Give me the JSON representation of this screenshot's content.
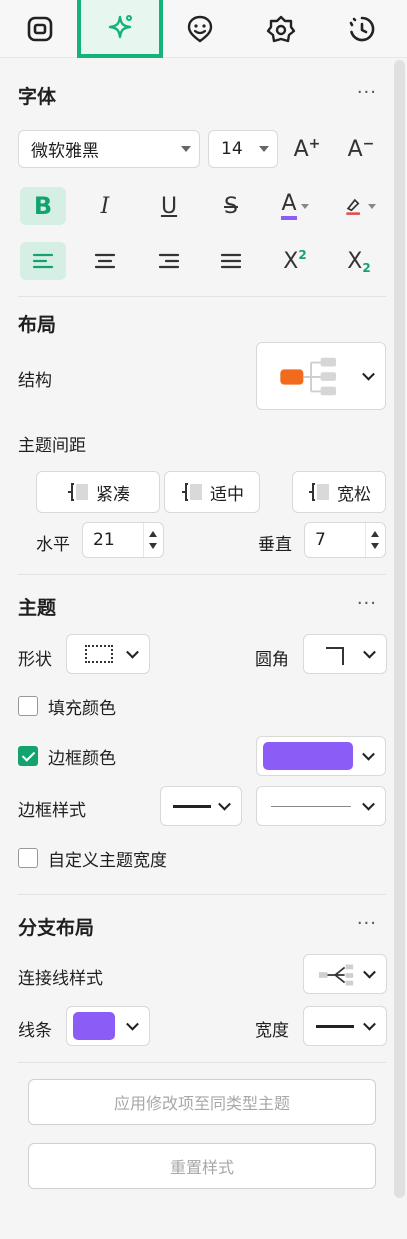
{
  "tabs": [
    {
      "name": "frame-icon"
    },
    {
      "name": "sparkle-icon",
      "active": true
    },
    {
      "name": "face-icon"
    },
    {
      "name": "badge-icon"
    },
    {
      "name": "clock-icon"
    }
  ],
  "font_section": {
    "title": "字体",
    "more": "···",
    "font_family": "微软雅黑",
    "font_size": "14",
    "increase_label": "A",
    "decrease_label": "A",
    "bold": "B",
    "italic": "I",
    "underline": "U",
    "strike": "S",
    "color_a": "A",
    "superscript": "X",
    "superscript_mark": "2",
    "subscript": "X",
    "subscript_mark": "2"
  },
  "layout_section": {
    "title": "布局",
    "structure_label": "结构",
    "spacing_label": "主题间距",
    "spacing_options": [
      "紧凑",
      "适中",
      "宽松"
    ],
    "horizontal_label": "水平",
    "horizontal_value": "21",
    "vertical_label": "垂直",
    "vertical_value": "7"
  },
  "topic_section": {
    "title": "主题",
    "more": "···",
    "shape_label": "形状",
    "corner_label": "圆角",
    "fill_color_label": "填充颜色",
    "border_color_label": "边框颜色",
    "border_style_label": "边框样式",
    "custom_width_label": "自定义主题宽度",
    "border_color": "#8b5cf6"
  },
  "branch_section": {
    "title": "分支布局",
    "more": "···",
    "connector_label": "连接线样式",
    "line_label": "线条",
    "width_label": "宽度",
    "line_color": "#8b5cf6"
  },
  "actions": {
    "apply_label": "应用修改项至同类型主题",
    "reset_label": "重置样式"
  },
  "colors": {
    "accent": "#13b37a",
    "orange": "#f26b1d"
  }
}
